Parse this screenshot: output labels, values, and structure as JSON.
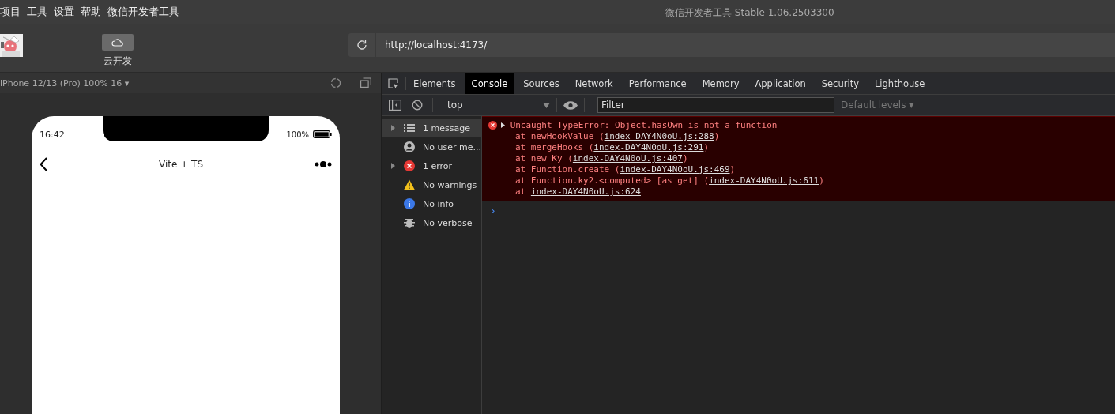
{
  "menu": [
    "项目",
    "工具",
    "设置",
    "帮助",
    "微信开发者工具"
  ],
  "window": {
    "title": "微信开发者工具 Stable 1.06.2503300"
  },
  "toolbar": {
    "cloud_button": {
      "label": "云开发"
    },
    "url": "http://localhost:4173/"
  },
  "simulator": {
    "device": "iPhone 12/13 (Pro) 100% 16 ▾",
    "phone": {
      "time": "16:42",
      "battery": "100%",
      "nav_title": "Vite + TS"
    }
  },
  "devtools": {
    "tabs": [
      {
        "label": "Elements",
        "selected": false
      },
      {
        "label": "Console",
        "selected": true
      },
      {
        "label": "Sources",
        "selected": false
      },
      {
        "label": "Network",
        "selected": false
      },
      {
        "label": "Performance",
        "selected": false
      },
      {
        "label": "Memory",
        "selected": false
      },
      {
        "label": "Application",
        "selected": false
      },
      {
        "label": "Security",
        "selected": false
      },
      {
        "label": "Lighthouse",
        "selected": false
      }
    ],
    "console_toolbar": {
      "context": "top",
      "filter_placeholder": "Filter",
      "levels": "Default levels ▾"
    },
    "sidebar": [
      {
        "kind": "list",
        "label": "1 message",
        "expandable": true,
        "selected": true
      },
      {
        "kind": "user",
        "label": "No user me...",
        "expandable": false,
        "selected": false
      },
      {
        "kind": "error",
        "label": "1 error",
        "expandable": true,
        "selected": false
      },
      {
        "kind": "warning",
        "label": "No warnings",
        "expandable": false,
        "selected": false
      },
      {
        "kind": "info",
        "label": "No info",
        "expandable": false,
        "selected": false
      },
      {
        "kind": "verbose",
        "label": "No verbose",
        "expandable": false,
        "selected": false
      }
    ],
    "error": {
      "message": "Uncaught TypeError: Object.hasOwn is not a function",
      "stack": [
        {
          "prefix": "at newHookValue (",
          "link": "index-DAY4N0oU.js:288",
          "suffix": ")"
        },
        {
          "prefix": "at mergeHooks (",
          "link": "index-DAY4N0oU.js:291",
          "suffix": ")"
        },
        {
          "prefix": "at new Ky (",
          "link": "index-DAY4N0oU.js:407",
          "suffix": ")"
        },
        {
          "prefix": "at Function.create (",
          "link": "index-DAY4N0oU.js:469",
          "suffix": ")"
        },
        {
          "prefix": "at Function.ky2.<computed> [as get] (",
          "link": "index-DAY4N0oU.js:611",
          "suffix": ")"
        },
        {
          "prefix": "at ",
          "link": "index-DAY4N0oU.js:624"
        }
      ]
    },
    "prompt": "›"
  }
}
